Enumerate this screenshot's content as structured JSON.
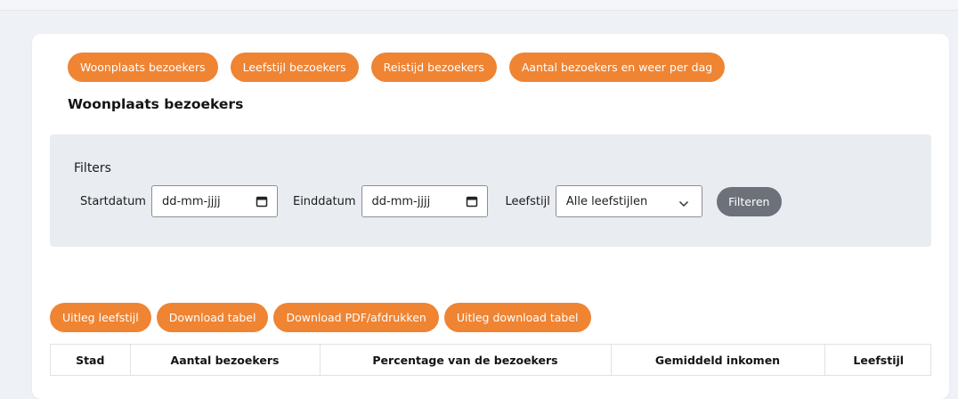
{
  "tabs": [
    {
      "label": "Woonplaats bezoekers"
    },
    {
      "label": "Leefstijl bezoekers"
    },
    {
      "label": "Reistijd bezoekers"
    },
    {
      "label": "Aantal bezoekers en weer per dag"
    }
  ],
  "page_title": "Woonplaats bezoekers",
  "filters": {
    "heading": "Filters",
    "start_label": "Startdatum",
    "start_placeholder": "dd-mm-jjjj",
    "end_label": "Einddatum",
    "end_placeholder": "dd-mm-jjjj",
    "leefstijl_label": "Leefstijl",
    "leefstijl_value": "Alle leefstijlen",
    "submit_label": "Filteren"
  },
  "actions": [
    {
      "label": "Uitleg leefstijl"
    },
    {
      "label": "Download tabel"
    },
    {
      "label": "Download PDF/afdrukken"
    },
    {
      "label": "Uitleg download tabel"
    }
  ],
  "table": {
    "columns": [
      "Stad",
      "Aantal bezoekers",
      "Percentage van de bezoekers",
      "Gemiddeld inkomen",
      "Leefstijl"
    ]
  },
  "icons": {
    "calendar": "calendar-icon",
    "chevron": "chevron-down-icon"
  },
  "colors": {
    "accent": "#ef8433",
    "filter_button": "#6d717a",
    "filter_panel": "#e9ecf1",
    "page_background": "#eef1f5"
  }
}
